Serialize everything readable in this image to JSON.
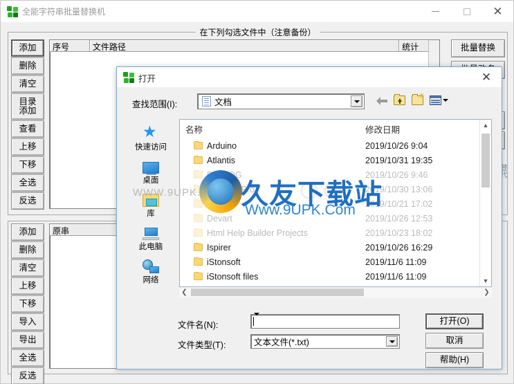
{
  "main_window": {
    "title": "全能字符串批量替换机",
    "icon": "green-puzzle-icon",
    "window_controls": {
      "minimize": "–",
      "maximize": "□",
      "close": "✕"
    },
    "file_group": {
      "legend": "在下列勾选文件中（注意备份）",
      "columns": [
        "序号",
        "文件路径",
        "统计"
      ],
      "rows": [],
      "buttons": [
        "添加",
        "删除",
        "清空",
        "目录",
        "添加",
        "查看",
        "上移",
        "下移",
        "全选",
        "反选"
      ],
      "button_items": [
        {
          "label": "添加"
        },
        {
          "label": "删除"
        },
        {
          "label": "清空"
        },
        {
          "label_line1": "目录",
          "label_line2": "添加"
        },
        {
          "label": "查看"
        },
        {
          "label": "上移"
        },
        {
          "label": "下移"
        },
        {
          "label": "全选"
        },
        {
          "label": "反选"
        }
      ]
    },
    "string_group": {
      "columns": [
        "原串"
      ],
      "rows": [],
      "button_items": [
        {
          "label": "添加"
        },
        {
          "label": "删除"
        },
        {
          "label": "清空"
        },
        {
          "label": "上移"
        },
        {
          "label": "下移"
        },
        {
          "label": "导入"
        },
        {
          "label": "导出"
        },
        {
          "label": "全选"
        },
        {
          "label": "反选"
        }
      ]
    },
    "action_buttons": [
      {
        "label": "批量替换"
      },
      {
        "label": "批量改名"
      }
    ]
  },
  "dialog": {
    "title": "打开",
    "icon": "green-puzzle-icon",
    "close_label": "✕",
    "lookin_label": "查找范围(I):",
    "lookin_value": "文档",
    "toolbar_icons": [
      "back-arrow-icon",
      "up-folder-icon",
      "new-folder-icon",
      "views-dropdown-icon"
    ],
    "places": [
      {
        "label": "快速访问",
        "icon": "star-icon"
      },
      {
        "label": "桌面",
        "icon": "monitor-icon"
      },
      {
        "label": "库",
        "icon": "library-folder-icon"
      },
      {
        "label": "此电脑",
        "icon": "this-pc-icon"
      },
      {
        "label": "网络",
        "icon": "network-icon"
      }
    ],
    "list": {
      "name_header": "名称",
      "date_header": "修改日期",
      "items": [
        {
          "name": "Arduino",
          "date": "2019/10/26 9:04",
          "obscured": false
        },
        {
          "name": "Atlantis",
          "date": "2019/10/31 19:35",
          "obscured": false
        },
        {
          "name": "DB2LOG",
          "date": "2019/10/26 9:46",
          "obscured": true
        },
        {
          "name": "ManagerPro",
          "date": "2019/10/30 13:06",
          "obscured": true
        },
        {
          "name": "",
          "date": "2019/10/21 17:02",
          "obscured": true
        },
        {
          "name": "Devart",
          "date": "2019/10/26 12:53",
          "obscured": true
        },
        {
          "name": "Html Help Builder Projects",
          "date": "2019/10/23 18:02",
          "obscured": true
        },
        {
          "name": "Ispirer",
          "date": "2019/10/26 16:29",
          "obscured": false
        },
        {
          "name": "iStonsoft",
          "date": "2019/11/6 11:09",
          "obscured": false
        },
        {
          "name": "iStonsoft files",
          "date": "2019/11/6 11:09",
          "obscured": false
        }
      ]
    },
    "filename_label": "文件名(N):",
    "filename_value": "",
    "filetype_label": "文件类型(T):",
    "filetype_value": "文本文件(*.txt)",
    "buttons": [
      {
        "label": "打开(O)",
        "default": true
      },
      {
        "label": "取消",
        "default": false
      },
      {
        "label": "帮助(H)",
        "default": false
      }
    ]
  },
  "watermark": {
    "cn_text": "久友下载站",
    "url_text": "Www.9UPK.Com",
    "url_small": "WWW.9UPK.COM"
  },
  "colors": {
    "window_bg": "#f0f0f0",
    "titlebar": "#ffffff",
    "dialog_border": "#7aa7d0",
    "watermark_blue": "#1f6fc0",
    "folder_yellow": "#fbd77a"
  }
}
